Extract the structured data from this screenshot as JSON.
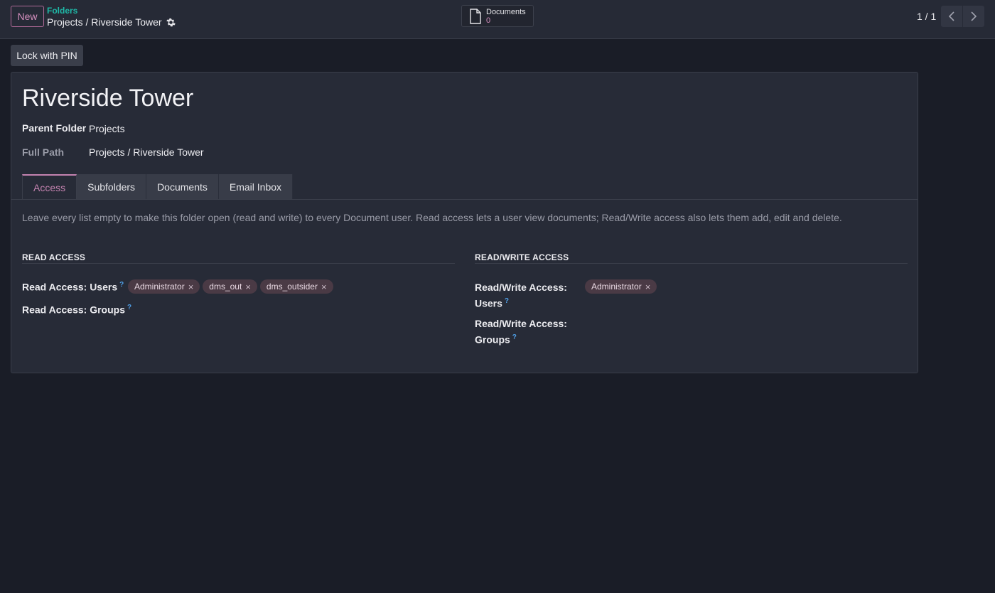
{
  "header": {
    "new_label": "New",
    "breadcrumb_parent": "Folders",
    "breadcrumb_current": "Projects / Riverside Tower",
    "smart_button_label": "Documents",
    "smart_button_count": "0",
    "pager_value": "1 / 1"
  },
  "actions": {
    "lock_label": "Lock with PIN"
  },
  "record": {
    "title": "Riverside Tower",
    "parent_folder_label": "Parent Folder",
    "parent_folder_value": "Projects",
    "full_path_label": "Full Path",
    "full_path_value": "Projects / Riverside Tower"
  },
  "tabs": [
    {
      "label": "Access"
    },
    {
      "label": "Subfolders"
    },
    {
      "label": "Documents"
    },
    {
      "label": "Email Inbox"
    }
  ],
  "access": {
    "help_text": "Leave every list empty to make this folder open (read and write) to every Document user. Read access lets a user view documents; Read/Write access also lets them add, edit and delete.",
    "read_group_title": "READ ACCESS",
    "read_users_label": "Read Access: Users",
    "read_users_tags": [
      "Administrator",
      "dms_out",
      "dms_outsider"
    ],
    "read_groups_label": "Read Access: Groups",
    "write_group_title": "READ/WRITE ACCESS",
    "write_users_label_1": "Read/Write Access:",
    "write_users_label_2": "Users",
    "write_users_tags": [
      "Administrator"
    ],
    "write_groups_label_1": "Read/Write Access:",
    "write_groups_label_2": "Groups",
    "help_mark": "?",
    "remove_mark": "×"
  },
  "colors": {
    "accent": "#c483b0",
    "breadcrumb": "#1fb8a7",
    "background": "#1a1d27"
  }
}
